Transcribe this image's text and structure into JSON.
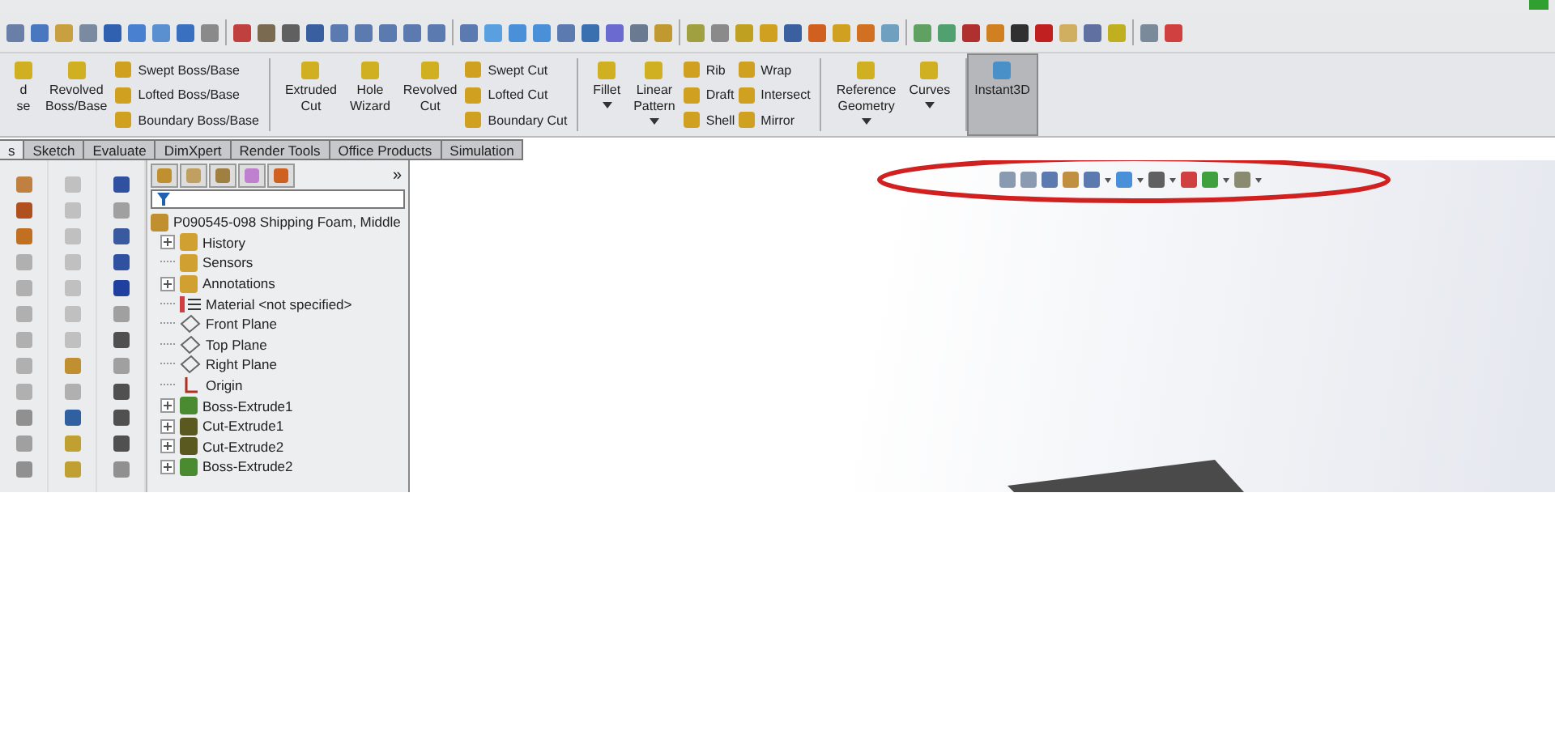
{
  "ribbon": {
    "groups": [
      {
        "large": [
          {
            "label": "d\nse",
            "dropdown": false
          },
          {
            "label": "Revolved\nBoss/Base",
            "dropdown": false
          }
        ],
        "columns": [
          [
            "Swept Boss/Base",
            "Lofted Boss/Base",
            "Boundary Boss/Base"
          ]
        ]
      },
      {
        "large": [
          {
            "label": "Extruded\nCut",
            "dropdown": false
          },
          {
            "label": "Hole\nWizard",
            "dropdown": false
          },
          {
            "label": "Revolved\nCut",
            "dropdown": false
          }
        ],
        "columns": [
          [
            "Swept Cut",
            "Lofted Cut",
            "Boundary Cut"
          ]
        ]
      },
      {
        "large": [
          {
            "label": "Fillet",
            "dropdown": true
          },
          {
            "label": "Linear\nPattern",
            "dropdown": true
          }
        ],
        "columns": [
          [
            "Rib",
            "Draft",
            "Shell"
          ],
          [
            "Wrap",
            "Intersect",
            "Mirror"
          ]
        ]
      },
      {
        "large": [
          {
            "label": "Reference\nGeometry",
            "dropdown": true
          },
          {
            "label": "Curves",
            "dropdown": true
          }
        ]
      }
    ],
    "toggle": {
      "label": "Instant3D",
      "on": true
    }
  },
  "tabs": [
    {
      "label": "s",
      "selected": true
    },
    {
      "label": "Sketch",
      "selected": false
    },
    {
      "label": "Evaluate",
      "selected": false
    },
    {
      "label": "DimXpert",
      "selected": false
    },
    {
      "label": "Render Tools",
      "selected": false
    },
    {
      "label": "Office Products",
      "selected": false
    },
    {
      "label": "Simulation",
      "selected": false
    }
  ],
  "tree_panel": {
    "more": "»",
    "root": "P090545-098 Shipping Foam, Middle",
    "items": [
      {
        "label": "History",
        "kind": "history",
        "expandable": true
      },
      {
        "label": "Sensors",
        "kind": "sensors",
        "expandable": false
      },
      {
        "label": "Annotations",
        "kind": "annotations",
        "expandable": true
      },
      {
        "label": "Material <not specified>",
        "kind": "material",
        "expandable": false
      },
      {
        "label": "Front Plane",
        "kind": "plane",
        "expandable": false
      },
      {
        "label": "Top Plane",
        "kind": "plane",
        "expandable": false
      },
      {
        "label": "Right Plane",
        "kind": "plane",
        "expandable": false
      },
      {
        "label": "Origin",
        "kind": "origin",
        "expandable": false
      },
      {
        "label": "Boss-Extrude1",
        "kind": "boss",
        "expandable": true
      },
      {
        "label": "Cut-Extrude1",
        "kind": "cut",
        "expandable": true
      },
      {
        "label": "Cut-Extrude2",
        "kind": "cut",
        "expandable": true
      },
      {
        "label": "Boss-Extrude2",
        "kind": "boss",
        "expandable": true
      }
    ]
  }
}
